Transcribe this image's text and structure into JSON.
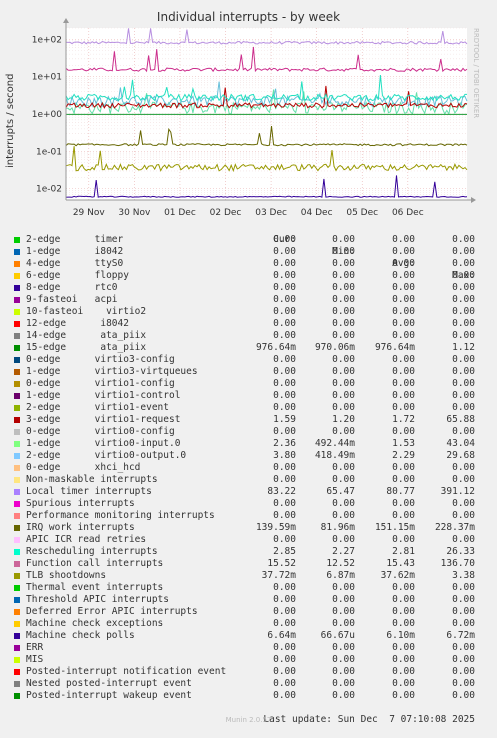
{
  "title": "Individual interrupts - by week",
  "side_label": "RRDTOOL / TOBI OETIKER",
  "footer": "Munin 2.0.57",
  "last_update": "Last update: Sun Dec  7 07:10:08 2025",
  "legend_headers": {
    "cur": "Cur:",
    "min": "Min:",
    "avg": "Avg:",
    "max": "Max:"
  },
  "chart_data": {
    "type": "line",
    "title": "Individual interrupts - by week",
    "ylabel": "interrupts / second",
    "xlabel": "",
    "yscale": "log",
    "ylim": [
      0.005,
      200
    ],
    "yticks": [
      0.01,
      0.1,
      1,
      10,
      100
    ],
    "ytick_labels": [
      "1e-02",
      "1e-01",
      "1e+00",
      "1e+01",
      "1e+02"
    ],
    "xlim": [
      "2025-11-28T12:00",
      "2025-12-07T07:10"
    ],
    "x_ticks": [
      "2025-11-29",
      "2025-11-30",
      "2025-12-01",
      "2025-12-02",
      "2025-12-03",
      "2025-12-04",
      "2025-12-05",
      "2025-12-06"
    ],
    "x_tick_labels": [
      "29 Nov",
      "30 Nov",
      "01 Dec",
      "02 Dec",
      "03 Dec",
      "04 Dec",
      "05 Dec",
      "06 Dec"
    ],
    "grid": true,
    "series": [
      {
        "name": "Local timer interrupts",
        "color": "#b78fe0",
        "level": 80.77,
        "spread": 0.08
      },
      {
        "name": "Function call interrupts",
        "color": "#cc2e8c",
        "level": 15.43,
        "spread": 0.1
      },
      {
        "name": "1-edge virtio0-input.0",
        "color": "#66e0ab",
        "level": 1.53,
        "spread": 0.35
      },
      {
        "name": "2-edge virtio0-output.0",
        "color": "#66bfd9",
        "level": 2.29,
        "spread": 0.3
      },
      {
        "name": "3-edge virtio1-request",
        "color": "#b80000",
        "level": 1.72,
        "spread": 0.15
      },
      {
        "name": "Rescheduling interrupts",
        "color": "#21e0c0",
        "level": 2.81,
        "spread": 0.2
      },
      {
        "name": "15-edge ata_piix",
        "color": "#1a9933",
        "level": 0.976,
        "spread": 0.0
      },
      {
        "name": "IRQ work interrupts",
        "color": "#666600",
        "level": 0.151,
        "spread": 0.06
      },
      {
        "name": "TLB shootdowns",
        "color": "#999900",
        "level": 0.0376,
        "spread": 0.2
      },
      {
        "name": "Machine check polls",
        "color": "#330099",
        "level": 0.0061,
        "spread": 0.03
      }
    ],
    "legend": [
      {
        "name": "2-edge      timer",
        "color": "#00cc00",
        "cur": "0.00",
        "min": "0.00",
        "avg": "0.00",
        "max": "0.00"
      },
      {
        "name": "1-edge      i8042",
        "color": "#0066b3",
        "cur": "0.00",
        "min": "0.00",
        "avg": "0.00",
        "max": "0.00"
      },
      {
        "name": "4-edge      ttyS0",
        "color": "#ff8000",
        "cur": "0.00",
        "min": "0.00",
        "avg": "0.00",
        "max": "0.00"
      },
      {
        "name": "6-edge      floppy",
        "color": "#ffcc00",
        "cur": "0.00",
        "min": "0.00",
        "avg": "0.00",
        "max": "0.00"
      },
      {
        "name": "8-edge      rtc0",
        "color": "#330099",
        "cur": "0.00",
        "min": "0.00",
        "avg": "0.00",
        "max": "0.00"
      },
      {
        "name": "9-fasteoi   acpi",
        "color": "#990099",
        "cur": "0.00",
        "min": "0.00",
        "avg": "0.00",
        "max": "0.00"
      },
      {
        "name": "10-fasteoi    virtio2",
        "color": "#ccff00",
        "cur": "0.00",
        "min": "0.00",
        "avg": "0.00",
        "max": "0.00"
      },
      {
        "name": "12-edge      i8042",
        "color": "#ff0000",
        "cur": "0.00",
        "min": "0.00",
        "avg": "0.00",
        "max": "0.00"
      },
      {
        "name": "14-edge      ata_piix",
        "color": "#808080",
        "cur": "0.00",
        "min": "0.00",
        "avg": "0.00",
        "max": "0.00"
      },
      {
        "name": "15-edge      ata_piix",
        "color": "#008f00",
        "cur": "976.64m",
        "min": "970.06m",
        "avg": "976.64m",
        "max": "1.12"
      },
      {
        "name": "0-edge      virtio3-config",
        "color": "#00487d",
        "cur": "0.00",
        "min": "0.00",
        "avg": "0.00",
        "max": "0.00"
      },
      {
        "name": "1-edge      virtio3-virtqueues",
        "color": "#b35a00",
        "cur": "0.00",
        "min": "0.00",
        "avg": "0.00",
        "max": "0.00"
      },
      {
        "name": "0-edge      virtio1-config",
        "color": "#b38f00",
        "cur": "0.00",
        "min": "0.00",
        "avg": "0.00",
        "max": "0.00"
      },
      {
        "name": "1-edge      virtio1-control",
        "color": "#6b006b",
        "cur": "0.00",
        "min": "0.00",
        "avg": "0.00",
        "max": "0.00"
      },
      {
        "name": "2-edge      virtio1-event",
        "color": "#8fb300",
        "cur": "0.00",
        "min": "0.00",
        "avg": "0.00",
        "max": "0.00"
      },
      {
        "name": "3-edge      virtio1-request",
        "color": "#b30000",
        "cur": "1.59",
        "min": "1.20",
        "avg": "1.72",
        "max": "65.88"
      },
      {
        "name": "0-edge      virtio0-config",
        "color": "#bebebe",
        "cur": "0.00",
        "min": "0.00",
        "avg": "0.00",
        "max": "0.00"
      },
      {
        "name": "1-edge      virtio0-input.0",
        "color": "#80ff80",
        "cur": "2.36",
        "min": "492.44m",
        "avg": "1.53",
        "max": "43.04"
      },
      {
        "name": "2-edge      virtio0-output.0",
        "color": "#80c9ff",
        "cur": "3.80",
        "min": "418.49m",
        "avg": "2.29",
        "max": "29.68"
      },
      {
        "name": "0-edge      xhci_hcd",
        "color": "#ffc080",
        "cur": "0.00",
        "min": "0.00",
        "avg": "0.00",
        "max": "0.00"
      },
      {
        "name": "Non-maskable interrupts",
        "color": "#ffe680",
        "cur": "0.00",
        "min": "0.00",
        "avg": "0.00",
        "max": "0.00"
      },
      {
        "name": "Local timer interrupts",
        "color": "#aa80ff",
        "cur": "83.22",
        "min": "65.47",
        "avg": "80.77",
        "max": "391.12"
      },
      {
        "name": "Spurious interrupts",
        "color": "#ee00cc",
        "cur": "0.00",
        "min": "0.00",
        "avg": "0.00",
        "max": "0.00"
      },
      {
        "name": "Performance monitoring interrupts",
        "color": "#ff8080",
        "cur": "0.00",
        "min": "0.00",
        "avg": "0.00",
        "max": "0.00"
      },
      {
        "name": "IRQ work interrupts",
        "color": "#666600",
        "cur": "139.59m",
        "min": "81.96m",
        "avg": "151.15m",
        "max": "228.37m"
      },
      {
        "name": "APIC ICR read retries",
        "color": "#ffbfff",
        "cur": "0.00",
        "min": "0.00",
        "avg": "0.00",
        "max": "0.00"
      },
      {
        "name": "Rescheduling interrupts",
        "color": "#00ffcc",
        "cur": "2.85",
        "min": "2.27",
        "avg": "2.81",
        "max": "26.33"
      },
      {
        "name": "Function call interrupts",
        "color": "#cc6699",
        "cur": "15.52",
        "min": "12.52",
        "avg": "15.43",
        "max": "136.70"
      },
      {
        "name": "TLB shootdowns",
        "color": "#999900",
        "cur": "37.72m",
        "min": "6.87m",
        "avg": "37.62m",
        "max": "3.38"
      },
      {
        "name": "Thermal event interrupts",
        "color": "#00cc00",
        "cur": "0.00",
        "min": "0.00",
        "avg": "0.00",
        "max": "0.00"
      },
      {
        "name": "Threshold APIC interrupts",
        "color": "#0066b3",
        "cur": "0.00",
        "min": "0.00",
        "avg": "0.00",
        "max": "0.00"
      },
      {
        "name": "Deferred Error APIC interrupts",
        "color": "#ff8000",
        "cur": "0.00",
        "min": "0.00",
        "avg": "0.00",
        "max": "0.00"
      },
      {
        "name": "Machine check exceptions",
        "color": "#ffcc00",
        "cur": "0.00",
        "min": "0.00",
        "avg": "0.00",
        "max": "0.00"
      },
      {
        "name": "Machine check polls",
        "color": "#330099",
        "cur": "6.64m",
        "min": "66.67u",
        "avg": "6.10m",
        "max": "6.72m"
      },
      {
        "name": "ERR",
        "color": "#990099",
        "cur": "0.00",
        "min": "0.00",
        "avg": "0.00",
        "max": "0.00"
      },
      {
        "name": "MIS",
        "color": "#ccff00",
        "cur": "0.00",
        "min": "0.00",
        "avg": "0.00",
        "max": "0.00"
      },
      {
        "name": "Posted-interrupt notification event",
        "color": "#ff0000",
        "cur": "0.00",
        "min": "0.00",
        "avg": "0.00",
        "max": "0.00"
      },
      {
        "name": "Nested posted-interrupt event",
        "color": "#808080",
        "cur": "0.00",
        "min": "0.00",
        "avg": "0.00",
        "max": "0.00"
      },
      {
        "name": "Posted-interrupt wakeup event",
        "color": "#008f00",
        "cur": "0.00",
        "min": "0.00",
        "avg": "0.00",
        "max": "0.00"
      }
    ]
  }
}
